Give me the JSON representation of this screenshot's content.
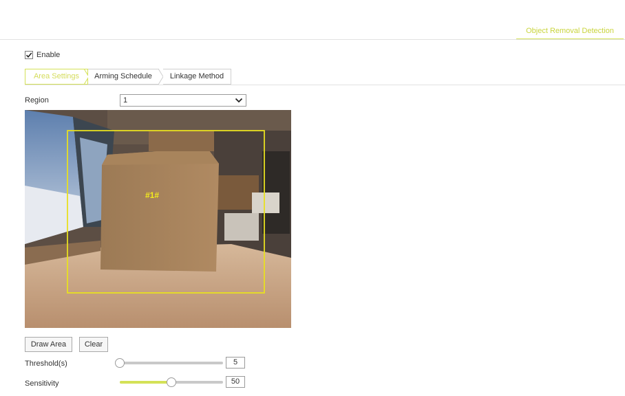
{
  "header": {
    "active_tab": "Object Removal Detection"
  },
  "enable": {
    "label": "Enable",
    "checked": true
  },
  "subtabs": [
    {
      "label": "Area Settings",
      "active": true
    },
    {
      "label": "Arming Schedule",
      "active": false
    },
    {
      "label": "Linkage Method",
      "active": false
    }
  ],
  "region": {
    "label": "Region",
    "value": "1"
  },
  "video": {
    "region_tag": "#1#"
  },
  "buttons": {
    "draw_area": "Draw Area",
    "clear": "Clear"
  },
  "threshold": {
    "label": "Threshold(s)",
    "value": "5",
    "min": 0,
    "max": 1800
  },
  "sensitivity": {
    "label": "Sensitivity",
    "value": "50",
    "min": 0,
    "max": 100
  },
  "colors": {
    "accent": "#d4e157",
    "region_box": "#e8e020"
  },
  "icons": {
    "checkbox": "checkmark-icon",
    "select": "chevron-down-icon"
  }
}
